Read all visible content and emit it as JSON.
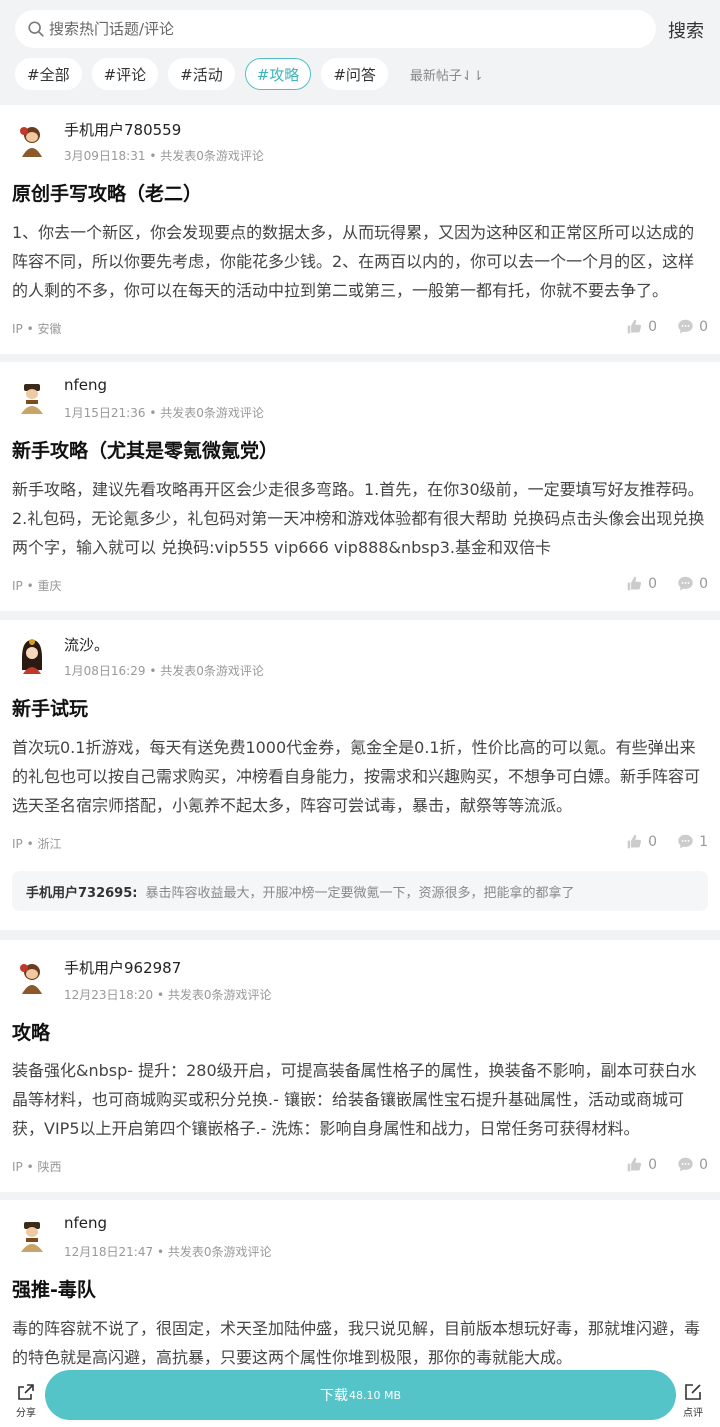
{
  "search": {
    "placeholder": "搜索热门话题/评论",
    "button": "搜索"
  },
  "tags": [
    "#全部",
    "#评论",
    "#活动",
    "#攻略",
    "#问答"
  ],
  "active_tag": "#攻略",
  "sort_label": "最新帖子⇃⇂",
  "posts": [
    {
      "user": "手机用户780559",
      "date": "3月09日18:31",
      "stat": "共发表0条游戏评论",
      "title": "原创手写攻略（老二）",
      "content": "1、你去一个新区，你会发现要点的数据太多，从而玩得累，又因为这种区和正常区所可以达成的阵容不同，所以你要先考虑，你能花多少钱。2、在两百以内的，你可以去一个一个月的区，这样的人剩的不多，你可以在每天的活动中拉到第二或第三，一般第一都有托，你就不要去争了。",
      "ip": "IP • 安徽",
      "likes": "0",
      "comments": "0"
    },
    {
      "user": "nfeng",
      "date": "1月15日21:36",
      "stat": "共发表0条游戏评论",
      "title": "新手攻略（尤其是零氪微氪党）",
      "content": "新手攻略，建议先看攻略再开区会少走很多弯路。1.首先，在你30级前，一定要填写好友推荐码。2.礼包码，无论氪多少，礼包码对第一天冲榜和游戏体验都有很大帮助 兑换码点击头像会出现兑换两个字，输入就可以 兑换码:vip555 vip666 vip888&nbsp3.基金和双倍卡",
      "ip": "IP • 重庆",
      "likes": "0",
      "comments": "0"
    },
    {
      "user": "流沙。",
      "date": "1月08日16:29",
      "stat": "共发表0条游戏评论",
      "title": "新手试玩",
      "content": "首次玩0.1折游戏，每天有送免费1000代金券，氪金全是0.1折，性价比高的可以氪。有些弹出来的礼包也可以按自己需求购买，冲榜看自身能力，按需求和兴趣购买，不想争可白嫖。新手阵容可选天圣名宿宗师搭配，小氪养不起太多，阵容可尝试毒，暴击，献祭等等流派。",
      "ip": "IP • 浙江",
      "likes": "0",
      "comments": "1",
      "reply": {
        "user": "手机用户732695:",
        "text": "暴击阵容收益最大，开服冲榜一定要微氪一下，资源很多，把能拿的都拿了"
      }
    },
    {
      "user": "手机用户962987",
      "date": "12月23日18:20",
      "stat": "共发表0条游戏评论",
      "title": "攻略",
      "content": "装备强化&nbsp- 提升：280级开启，可提高装备属性格子的属性，换装备不影响，副本可获白水晶等材料，也可商城购买或积分兑换.- 镶嵌：给装备镶嵌属性宝石提升基础属性，活动或商城可获，VIP5以上开启第四个镶嵌格子.- 洗炼：影响自身属性和战力，日常任务可获得材料。",
      "ip": "IP • 陕西",
      "likes": "0",
      "comments": "0"
    },
    {
      "user": "nfeng",
      "date": "12月18日21:47",
      "stat": "共发表0条游戏评论",
      "title": "强推-毒队",
      "content": "毒的阵容就不说了，很固定，术天圣加陆仲盛，我只说见解，目前版本想玩好毒，那就堆闪避，毒的特色就是高闪避，高抗暴，只要这两个属性你堆到极限，那你的毒就能大成。"
    }
  ],
  "bottom": {
    "share": "分享",
    "download": "下载",
    "size": "48.10 MB",
    "review": "点评"
  },
  "colors": {
    "accent": "#55c4c9",
    "tag_active": "#3fb5ba",
    "bg": "#f2f3f5"
  }
}
